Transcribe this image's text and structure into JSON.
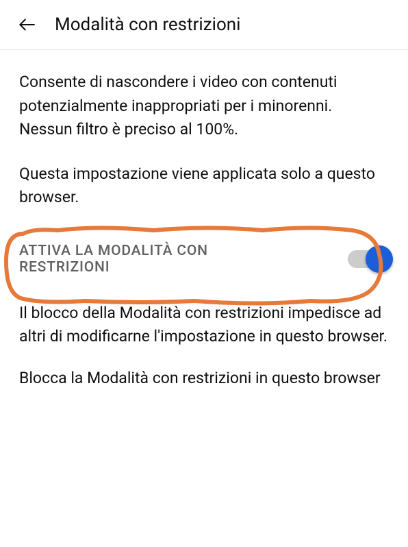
{
  "header": {
    "title": "Modalità con restrizioni"
  },
  "content": {
    "description": "Consente di nascondere i video con contenuti potenzialmente inappropriati per i minorenni. Nessun filtro è preciso al 100%.",
    "applied_to_browser": "Questa impostazione viene applicata solo a questo browser.",
    "toggle_label": "ATTIVA LA MODALITÀ CON RESTRIZIONI",
    "toggle_state": "on",
    "lock_info": "Il blocco della Modalità con restrizioni impedisce ad altri di modificarne l'impostazione in questo browser.",
    "lock_action": "Blocca la Modalità con restrizioni in questo browser"
  },
  "colors": {
    "accent": "#1a5fd8",
    "annotation": "#e67a3a"
  }
}
